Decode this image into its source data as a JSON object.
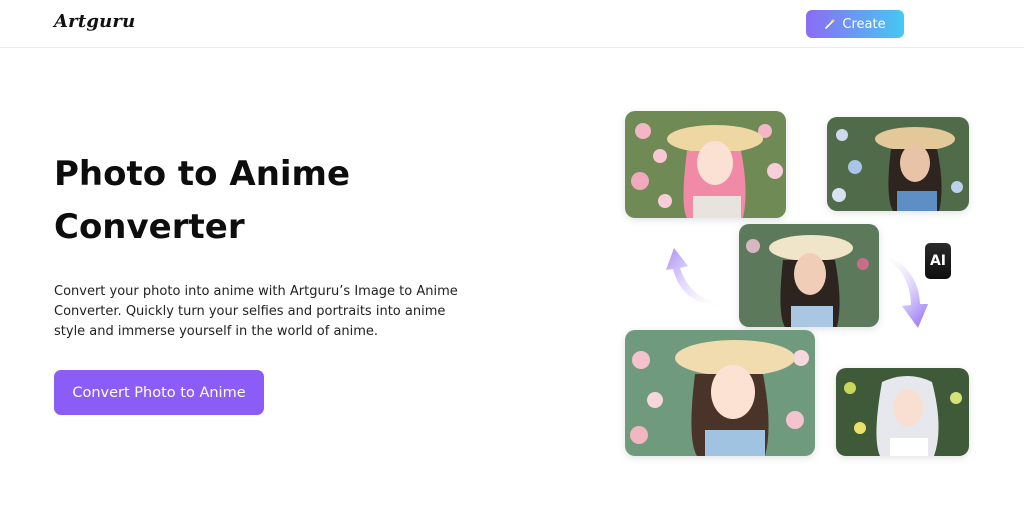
{
  "header": {
    "logo": "Artguru",
    "create_label": "Create"
  },
  "hero": {
    "title_line1": "Photo to Anime",
    "title_line2": "Converter",
    "description": "Convert your photo into anime with Artguru’s Image to Anime Converter. Quickly turn your selfies and portraits into anime style and immerse yourself in the world of anime.",
    "cta_label": "Convert Photo to Anime"
  },
  "showcase": {
    "ai_badge": "AI"
  },
  "colors": {
    "primary": "#8b5cf6",
    "create_gradient_start": "#8b6cf5",
    "create_gradient_end": "#45c8f2",
    "arrow": "#b59cf7"
  }
}
